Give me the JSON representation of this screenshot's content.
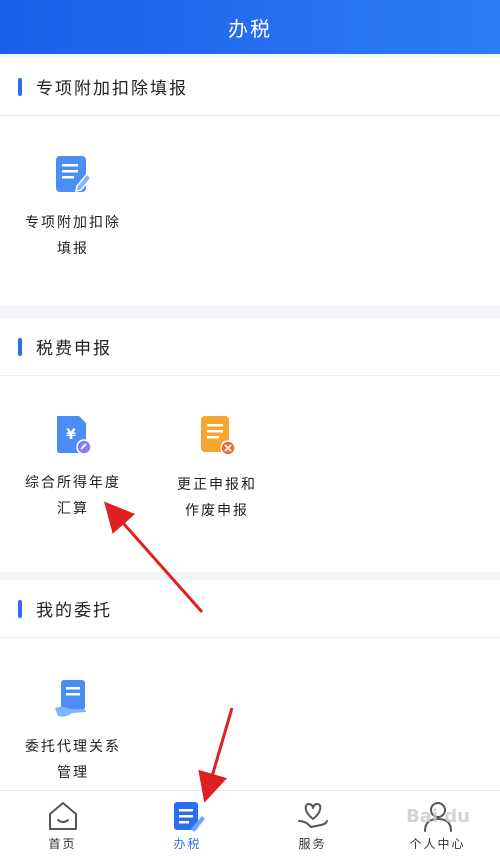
{
  "header": {
    "title": "办税"
  },
  "sections": [
    {
      "title": "专项附加扣除填报",
      "tiles": [
        {
          "label_line1": "专项附加扣除",
          "label_line2": "填报",
          "icon": "form-edit-icon"
        }
      ]
    },
    {
      "title": "税费申报",
      "tiles": [
        {
          "label_line1": "综合所得年度",
          "label_line2": "汇算",
          "icon": "yuan-document-icon"
        },
        {
          "label_line1": "更正申报和",
          "label_line2": "作废申报",
          "icon": "document-cancel-icon"
        }
      ]
    },
    {
      "title": "我的委托",
      "tiles": [
        {
          "label_line1": "委托代理关系",
          "label_line2": "管理",
          "icon": "hand-document-icon"
        }
      ]
    }
  ],
  "tabbar": [
    {
      "label": "首页",
      "icon": "home-icon",
      "active": false
    },
    {
      "label": "办税",
      "icon": "tax-document-icon",
      "active": true
    },
    {
      "label": "服务",
      "icon": "hand-heart-icon",
      "active": false
    },
    {
      "label": "个人中心",
      "icon": "person-icon",
      "active": false
    }
  ],
  "watermark": "Bai du",
  "colors": {
    "accent": "#2b6ff0",
    "header_start": "#1a5fe8",
    "header_end": "#2f7cf6",
    "annotation_arrow": "#e02020",
    "tile_orange": "#f7a531"
  }
}
